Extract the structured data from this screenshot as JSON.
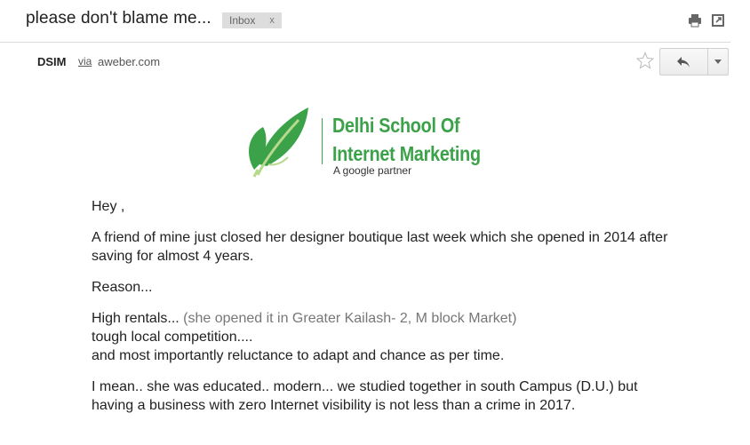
{
  "header": {
    "subject": "please don't blame me...",
    "label": "Inbox",
    "label_remove": "x"
  },
  "sender": {
    "name": "DSIM",
    "via": "via",
    "domain": "aweber.com"
  },
  "icons": {
    "print": "printer-icon",
    "new_window": "new-window-icon",
    "star": "star-icon",
    "reply": "reply-arrow-icon",
    "more": "chevron-down-icon",
    "logo_leaf": "leaf-icon"
  },
  "logo": {
    "line1": "Delhi School Of",
    "line2": "Internet Marketing",
    "tagline": "A google partner",
    "color": "#3ba24a"
  },
  "body": {
    "greeting": "Hey ,",
    "p1": "A friend of mine just closed her designer boutique last week which she opened in 2014 after saving for almost 4 years.",
    "p2": "Reason...",
    "p3_a": "High rentals...",
    "p3_b": "(she opened it in Greater Kailash- 2, M block Market)",
    "p3_c": "tough local competition....",
    "p3_d": "and most importantly reluctance to adapt and chance as per time.",
    "p4": "I mean.. she was educated.. modern... we studied together in south Campus (D.U.) but having a business with zero Internet visibility is not less than a crime in 2017."
  }
}
